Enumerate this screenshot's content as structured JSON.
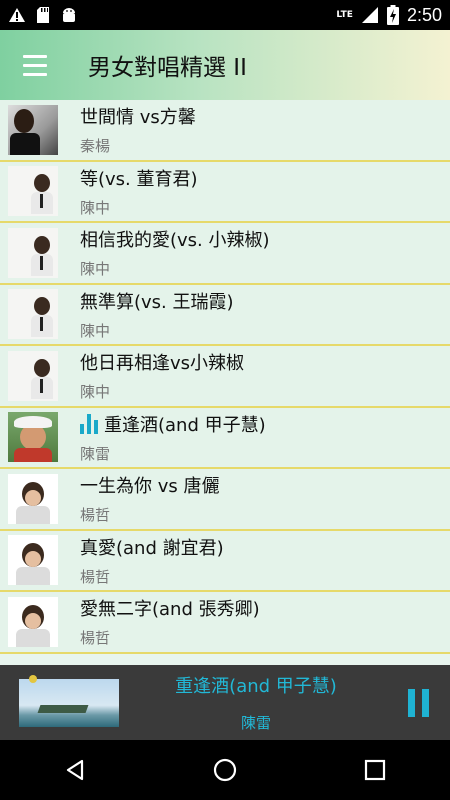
{
  "status_bar": {
    "time": "2:50",
    "network": "LTE",
    "battery_label": "battery-charging-icon",
    "icons": [
      "warning-icon",
      "sd-card-icon",
      "android-icon"
    ]
  },
  "app_bar": {
    "title": "男女對唱精選 II",
    "menu_icon": "menu-icon"
  },
  "songs": [
    {
      "title": "世間情 vs方馨",
      "artist": "秦楊",
      "playing": false,
      "thumb": "dark"
    },
    {
      "title": "等(vs. 董育君)",
      "artist": "陳中",
      "playing": false,
      "thumb": "light"
    },
    {
      "title": "相信我的愛(vs. 小辣椒)",
      "artist": "陳中",
      "playing": false,
      "thumb": "light"
    },
    {
      "title": "無準算(vs. 王瑞霞)",
      "artist": "陳中",
      "playing": false,
      "thumb": "light"
    },
    {
      "title": "他日再相逢vs小辣椒",
      "artist": "陳中",
      "playing": false,
      "thumb": "light"
    },
    {
      "title": "重逢酒(and 甲子慧)",
      "artist": "陳雷",
      "playing": true,
      "thumb": "chef"
    },
    {
      "title": "一生為你 vs 唐儷",
      "artist": "楊哲",
      "playing": false,
      "thumb": "white"
    },
    {
      "title": "真愛(and 謝宜君)",
      "artist": "楊哲",
      "playing": false,
      "thumb": "white"
    },
    {
      "title": "愛無二字(and 張秀卿)",
      "artist": "楊哲",
      "playing": false,
      "thumb": "white"
    }
  ],
  "now_playing": {
    "title": "重逢酒(and 甲子慧)",
    "artist": "陳雷",
    "control_icon": "pause-icon"
  },
  "colors": {
    "accent": "#1fb3d3",
    "divider": "#e6d96a",
    "list_bg": "#e4f3ea",
    "player_bg": "#3a3a3a"
  },
  "nav": [
    "back-icon",
    "home-icon",
    "recents-icon"
  ]
}
